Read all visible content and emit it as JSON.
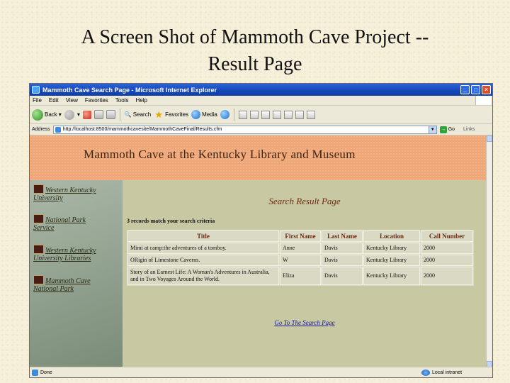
{
  "slide": {
    "title_line1": "A Screen Shot of Mammoth Cave Project --",
    "title_line2": "Result Page"
  },
  "window": {
    "title": "Mammoth Cave Search Page - Microsoft Internet Explorer",
    "controls": [
      "_",
      "□",
      "×"
    ]
  },
  "menu": [
    "File",
    "Edit",
    "View",
    "Favorites",
    "Tools",
    "Help"
  ],
  "toolbar": {
    "back": "Back",
    "search": "Search",
    "favorites": "Favorites",
    "media": "Media"
  },
  "address": {
    "label": "Address",
    "url": "http://localhost:8500/mammothcavesite/MammothCaveFinal/Results.cfm",
    "go": "Go",
    "links": "Links"
  },
  "page": {
    "banner_title": "Mammoth Cave at the Kentucky Library and Museum",
    "sidebar_links": [
      {
        "line1": "Western Kentucky",
        "line2": "University"
      },
      {
        "line1": "National Park",
        "line2": "Service"
      },
      {
        "line1": "Western Kentucky",
        "line2": "University Libraries"
      },
      {
        "line1": "Mammoth Cave",
        "line2": "National Park"
      }
    ],
    "heading": "Search Result Page",
    "match_text": "3 records match your search criteria",
    "columns": [
      "Title",
      "First Name",
      "Last Name",
      "Location",
      "Call Number"
    ],
    "rows": [
      {
        "title": "Mimi at camp:the adventures of a tomboy.",
        "first": "Anne",
        "last": "Davis",
        "location": "Kentucky Library",
        "call": "2000"
      },
      {
        "title": "ORigin of Limestone Caverns.",
        "first": "W",
        "last": "Davis",
        "location": "Kentucky Library",
        "call": "2000"
      },
      {
        "title": "Story of an Earnest Life: A Woman's Adventures in Australia, and in Two Voyages Around the World.",
        "first": "Eliza",
        "last": "Davis",
        "location": "Kentucky Library",
        "call": "2000"
      }
    ],
    "search_link": "Go To The Search Page"
  },
  "status": {
    "left": "Done",
    "zone": "Local intranet"
  }
}
